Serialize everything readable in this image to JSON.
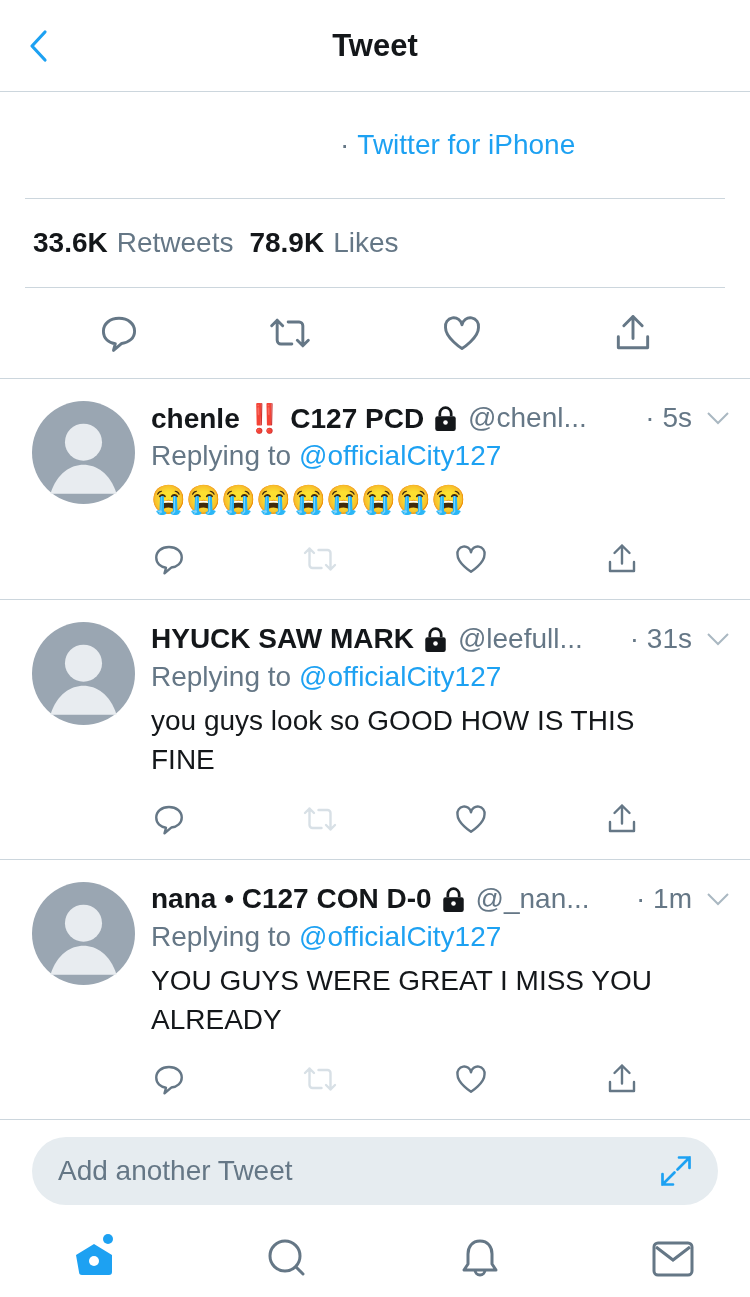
{
  "header": {
    "title": "Tweet"
  },
  "source": {
    "separator": "·",
    "client": "Twitter for iPhone"
  },
  "stats": [
    {
      "count": "33.6K",
      "label": "Retweets"
    },
    {
      "count": "78.9K",
      "label": "Likes"
    }
  ],
  "replies": [
    {
      "name": "chenle ‼️ C127 PCD",
      "protected": true,
      "handle": "@chenl...",
      "time": "· 5s",
      "replying_label": "Replying to",
      "replying_to": "@officialCity127",
      "text": "😭😭😭😭😭😭😭😭😭",
      "retweet_disabled": true
    },
    {
      "name": "HYUCK SAW MARK",
      "protected": true,
      "handle": "@leefull...",
      "time": "· 31s",
      "replying_label": "Replying to",
      "replying_to": "@officialCity127",
      "text": "you guys look so GOOD HOW IS THIS FINE",
      "retweet_disabled": true
    },
    {
      "name": "nana • C127 CON D-0",
      "protected": true,
      "handle": "@_nan...",
      "time": "· 1m",
      "replying_label": "Replying to",
      "replying_to": "@officialCity127",
      "text": "YOU GUYS WERE GREAT I MISS YOU ALREADY",
      "retweet_disabled": true
    }
  ],
  "composer": {
    "placeholder": "Add another Tweet"
  },
  "tab_bar": {
    "home_notification": true
  }
}
